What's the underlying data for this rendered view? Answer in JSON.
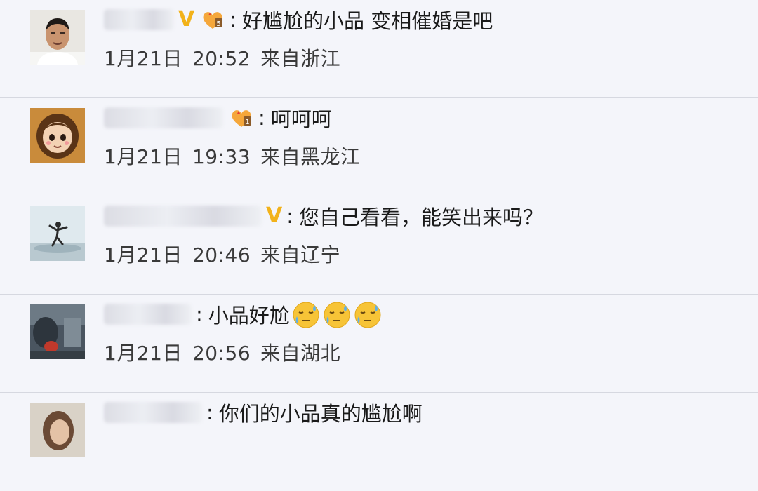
{
  "comments": [
    {
      "text": "好尴尬的小品 变相催婚是吧",
      "date": "1月21日",
      "time": "20:52",
      "location": "来自浙江",
      "verified": true,
      "fan_badge": "5",
      "avatar": "man-avatar"
    },
    {
      "text": "呵呵呵",
      "date": "1月21日",
      "time": "19:33",
      "location": "来自黑龙江",
      "verified": false,
      "fan_badge": "1",
      "avatar": "cartoon-girl-avatar"
    },
    {
      "text": "您自己看看，能笑出来吗？",
      "date": "1月21日",
      "time": "20:46",
      "location": "来自辽宁",
      "verified": true,
      "avatar": "jumping-person-avatar"
    },
    {
      "text": "小品好尬",
      "date": "1月21日",
      "time": "20:56",
      "location": "来自湖北",
      "verified": false,
      "emojis": [
        "sweat-emoji",
        "sweat-emoji",
        "sweat-emoji"
      ],
      "avatar": "dark-photo-avatar"
    },
    {
      "text": "你们的小品真的尴尬啊",
      "verified": false,
      "avatar": "woman-avatar"
    }
  ],
  "colors": {
    "background": "#f4f5fa",
    "verified_badge": "#f2b21a",
    "divider": "#d6d8e0"
  }
}
